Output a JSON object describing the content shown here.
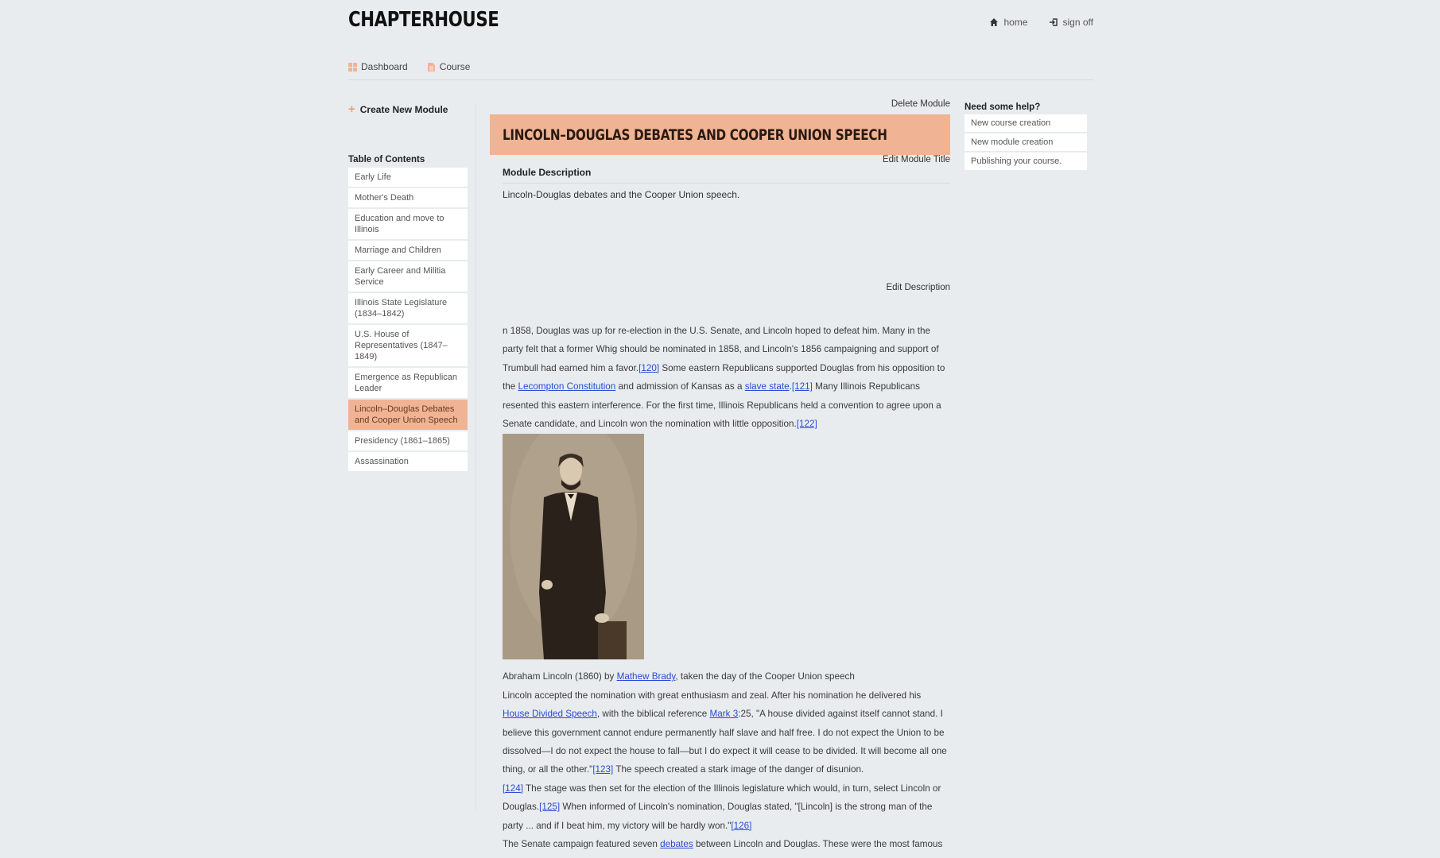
{
  "brand": "CHAPTERHOUSE",
  "topnav": {
    "home": "home",
    "signoff": "sign off"
  },
  "mainnav": {
    "dashboard": "Dashboard",
    "course": "Course"
  },
  "sidebar": {
    "create": "Create New Module",
    "toc_title": "Table of Contents",
    "items": [
      "Early Life",
      "Mother's Death",
      "Education and move to Illinois",
      "Marriage and Children",
      "Early Career and Militia Service",
      "Illinois State Legislature (1834–1842)",
      "U.S. House of Representatives (1847–1849)",
      "Emergence as Republican Leader",
      "Lincoln–Douglas Debates and Cooper Union Speech",
      "Presidency (1861–1865)",
      "Assassination"
    ]
  },
  "main": {
    "delete": "Delete Module",
    "title": "LINCOLN–DOUGLAS DEBATES AND COOPER UNION SPEECH",
    "edit_title": "Edit Module Title",
    "desc_head": "Module Description",
    "desc_text": "Lincoln-Douglas debates and the Cooper Union speech.",
    "edit_desc": "Edit Description",
    "p1_a": "n 1858, Douglas was up for re-election in the U.S. Senate, and Lincoln hoped to defeat him. Many in the party felt that a former Whig should be nominated in 1858, and Lincoln's 1856 campaigning and support of Trumbull had earned him a favor.",
    "ref120": "[120]",
    "p1_b": " Some eastern Republicans supported Douglas from his opposition to the ",
    "lecompton": "Lecompton Constitution",
    "p1_c": " and admission of Kansas as a ",
    "slave_state": "slave state",
    "p1_d": ".",
    "ref121": "[121]",
    "p1_e": " Many Illinois Republicans resented this eastern interference. For the first time, Illinois Republicans held a convention to agree upon a Senate candidate, and Lincoln won the nomination with little opposition.",
    "ref122": "[122]",
    "cap_a": "Abraham Lincoln (1860) by ",
    "brady": "Mathew Brady",
    "cap_b": ", taken the day of the Cooper Union speech",
    "p2_a": "Lincoln accepted the nomination with great enthusiasm and zeal. After his nomination he delivered his ",
    "house_divided": "House Divided Speech",
    "p2_b": ", with the biblical reference ",
    "mark": "Mark 3",
    "p2_c": ":25, \"A house divided against itself cannot stand. I believe this government cannot endure permanently half slave and half free. I do not expect the Union to be dissolved—I do not expect the house to fall—but I do expect it will cease to be divided. It will become all one thing, or all the other.\"",
    "ref123": "[123]",
    "p2_d": " The speech created a stark image of the danger of disunion.",
    "ref124": "[124]",
    "p2_e": " The stage was then set for the election of the Illinois legislature which would, in turn, select Lincoln or Douglas.",
    "ref125": "[125]",
    "p2_f": " When informed of Lincoln's nomination, Douglas stated, \"[Lincoln] is the strong man of the party ... and if I beat him, my victory will be hardly won.\"",
    "ref126": "[126]",
    "p3_a": "The Senate campaign featured seven ",
    "debates": "debates",
    "p3_b": " between Lincoln and Douglas. These were the most famous"
  },
  "help": {
    "title": "Need some help?",
    "items": [
      "New course creation",
      "New module creation",
      "Publishing your course."
    ]
  },
  "colors": {
    "accent": "#f0b494",
    "link": "#2a4ad8",
    "background": "#e9ecee"
  }
}
